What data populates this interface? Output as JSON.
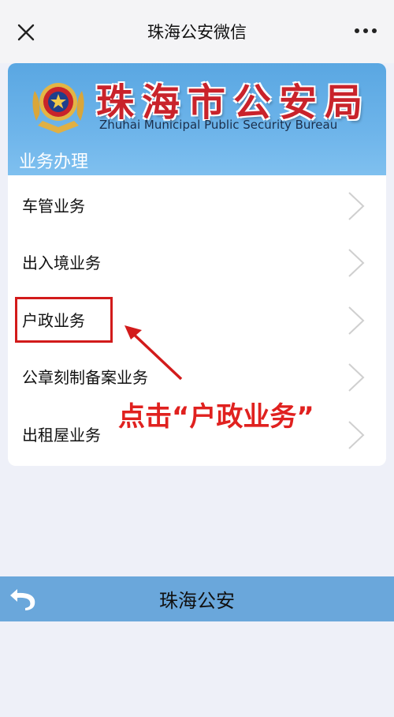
{
  "topbar": {
    "title": "珠海公安微信"
  },
  "banner": {
    "bureau_cn": "珠海市公安局",
    "bureau_en": "Zhuhai Municipal Public Security Bureau",
    "section": "业务办理"
  },
  "menu": [
    {
      "label": "车管业务"
    },
    {
      "label": "出入境业务"
    },
    {
      "label": "户政业务"
    },
    {
      "label": "公章刻制备案业务"
    },
    {
      "label": "出租屋业务"
    }
  ],
  "annotation": {
    "callout": "点击“户政业务”",
    "color": "#e0211f"
  },
  "footer": {
    "name": "珠海公安"
  },
  "colors": {
    "banner_blue": "#6db4ea",
    "footer_blue": "#6aa7db",
    "accent_red": "#d21b1b"
  },
  "icons": [
    "close-icon",
    "more-icon",
    "police-emblem",
    "chevron-right-icon",
    "back-icon"
  ]
}
